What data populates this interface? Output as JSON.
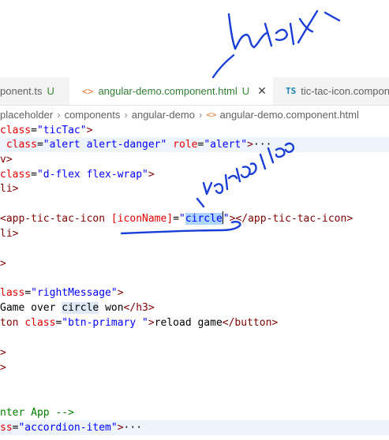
{
  "tabs": [
    {
      "icon": "html-file-icon",
      "name": "ponent.ts",
      "status": "U"
    },
    {
      "icon": "html-file-icon",
      "name": "angular-demo.component.html",
      "status": "U",
      "close": "✕"
    },
    {
      "icon": "typescript-file-icon",
      "name": "tic-tac-icon.compon",
      "icon_text": "TS"
    }
  ],
  "tab_html_icon": "<>",
  "breadcrumb": {
    "items": [
      "placeholder",
      "components",
      "angular-demo",
      "angular-demo.component.html"
    ],
    "sep": "›"
  },
  "code": {
    "l1": {
      "a": "class",
      "b": "=",
      "c": "\"ticTac\"",
      "d": ">"
    },
    "l2": {
      "a": " class",
      "b": "=",
      "c": "\"alert alert-danger\"",
      "d": " role",
      "e": "=",
      "f": "\"alert\"",
      "g": ">",
      "h": "···"
    },
    "l3": {
      "a": "v>"
    },
    "l4": {
      "a": "class",
      "b": "=",
      "c": "\"d-flex flex-wrap\"",
      "d": ">"
    },
    "l5": {
      "a": "li>"
    },
    "l6": {
      "a": "<app-tic-tac-icon ",
      "b": "[iconName]",
      "c": "=",
      "d": "\"",
      "e": "circle",
      "f": "\"",
      "g": "></app-tic-tac-icon>"
    },
    "l7": {
      "a": "li>"
    },
    "l8": {
      "a": ">"
    },
    "l9": {
      "a": "lass",
      "b": "=",
      "c": "\"rightMessage\"",
      "d": ">"
    },
    "l10": {
      "a": "Game over ",
      "b": "circle",
      "c": " won",
      "d": "</h3>"
    },
    "l11": {
      "a": "ton ",
      "b": "class",
      "c": "=",
      "d": "\"btn-primary \"",
      "e": ">",
      "f": "reload game",
      "g": "</button>"
    },
    "l12": {
      "a": ">"
    },
    "l13": {
      "a": ">"
    },
    "l14": {
      "a": "nter App -->"
    },
    "l15": {
      "a": "ss",
      "b": "=",
      "c": "\"accordion-item\"",
      "d": ">",
      "e": "···"
    }
  },
  "colors": {
    "tag": "#800000",
    "attr": "#e50000",
    "string": "#0000ff",
    "comment": "#008000",
    "ink": "#1a3fd6",
    "selection": "#add6ff"
  }
}
